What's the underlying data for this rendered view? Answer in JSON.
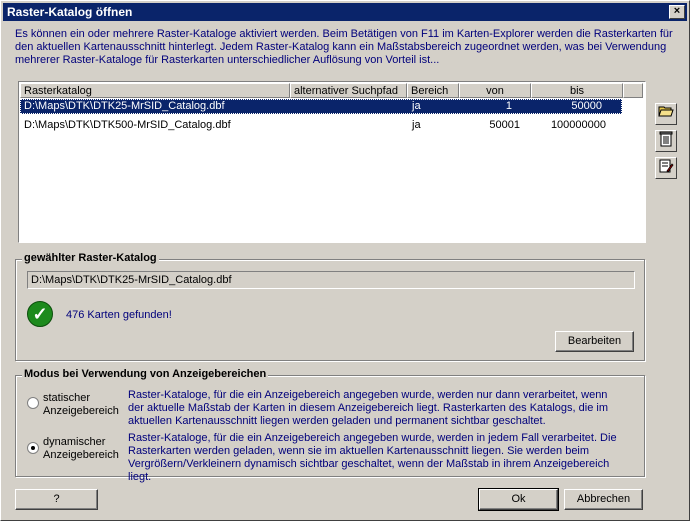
{
  "window": {
    "title": "Raster-Katalog öffnen",
    "close_label": "×"
  },
  "intro": "Es können ein oder mehrere Raster-Kataloge aktiviert werden. Beim Betätigen von F11 im Karten-Explorer werden die Rasterkarten für den aktuellen Kartenausschnitt hinterlegt. Jedem Raster-Katalog kann ein Maßstabsbereich zugeordnet werden, was bei Verwendung mehrerer Raster-Kataloge für Rasterkarten unterschiedlicher Auflösung von Vorteil ist...",
  "table": {
    "columns": [
      "Rasterkatalog",
      "alternativer Suchpfad",
      "Bereich",
      "von",
      "bis"
    ],
    "rows": [
      {
        "path": "D:\\Maps\\DTK\\DTK25-MrSID_Catalog.dbf",
        "alt": "",
        "bereich": "ja",
        "von": "1",
        "bis": "50000",
        "selected": true
      },
      {
        "path": "D:\\Maps\\DTK\\DTK500-MrSID_Catalog.dbf",
        "alt": "",
        "bereich": "ja",
        "von": "50001",
        "bis": "100000000",
        "selected": false
      }
    ]
  },
  "side_icons": [
    "open-folder-icon",
    "trash-icon",
    "edit-icon"
  ],
  "selected_group": {
    "legend": "gewählter Raster-Katalog",
    "path": "D:\\Maps\\DTK\\DTK25-MrSID_Catalog.dbf",
    "status": "476 Karten gefunden!",
    "edit_label": "Bearbeiten"
  },
  "mode_group": {
    "legend": "Modus bei Verwendung von Anzeigebereichen",
    "static_label_1": "statischer",
    "static_label_2": "Anzeigebereich",
    "static_desc": "Raster-Kataloge, für die ein Anzeigebereich angegeben wurde, werden nur dann verarbeitet, wenn der aktuelle Maßstab der Karten in diesem Anzeigebereich liegt. Rasterkarten des Katalogs, die im aktuellen Kartenausschnitt liegen werden geladen und permanent sichtbar geschaltet.",
    "dynamic_label_1": "dynamischer",
    "dynamic_label_2": "Anzeigebereich",
    "dynamic_desc": "Raster-Kataloge, für die ein Anzeigebereich angegeben wurde, werden in jedem Fall verarbeitet. Die Rasterkarten werden geladen, wenn sie im aktuellen Kartenausschnitt liegen. Sie werden beim Vergrößern/Verkleinern dynamisch sichtbar geschaltet, wenn der Maßstab in ihrem Anzeigebereich liegt.",
    "selected": "dynamic"
  },
  "buttons": {
    "help": "?",
    "ok": "Ok",
    "cancel": "Abbrechen"
  }
}
